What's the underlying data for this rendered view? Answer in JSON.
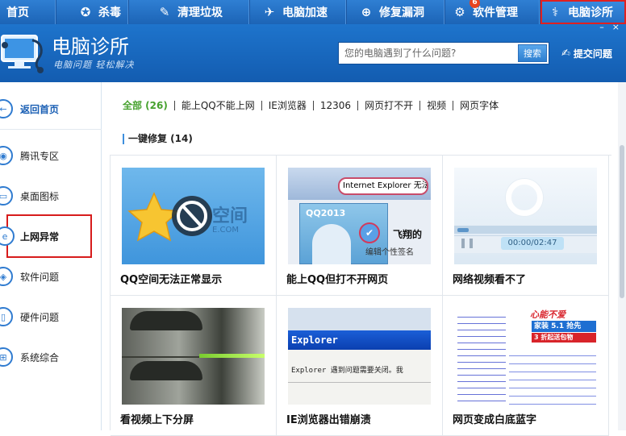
{
  "topnav": {
    "tabs": [
      {
        "label": "首页",
        "icon": "home-icon",
        "glyph": ""
      },
      {
        "label": "杀毒",
        "icon": "shield-icon",
        "glyph": "✪"
      },
      {
        "label": "清理垃圾",
        "icon": "broom-icon",
        "glyph": "✎"
      },
      {
        "label": "电脑加速",
        "icon": "rocket-icon",
        "glyph": "✈"
      },
      {
        "label": "修复漏洞",
        "icon": "repair-icon",
        "glyph": "⊕"
      },
      {
        "label": "软件管理",
        "icon": "software-icon",
        "glyph": "⚙",
        "badge": "6"
      },
      {
        "label": "电脑诊所",
        "icon": "stethoscope-icon",
        "glyph": "⚕"
      }
    ],
    "active_tab": "电脑诊所"
  },
  "header": {
    "title": "电脑诊所",
    "slogan": "电脑问题 轻松解决",
    "search": {
      "placeholder": "您的电脑遇到了什么问题?",
      "button_label": "搜索"
    },
    "feedback_label": "提交问题",
    "window_controls": {
      "minimize": "–",
      "close": "×"
    }
  },
  "sidebar": {
    "items": [
      {
        "label": "返回首页",
        "icon": "back-arrow-icon"
      },
      {
        "label": "腾讯专区",
        "icon": "penguin-icon"
      },
      {
        "label": "桌面图标",
        "icon": "desktop-icon"
      },
      {
        "label": "上网异常",
        "icon": "browser-icon"
      },
      {
        "label": "软件问题",
        "icon": "software-icon"
      },
      {
        "label": "硬件问题",
        "icon": "hardware-icon"
      },
      {
        "label": "系统综合",
        "icon": "windows-icon"
      }
    ],
    "active": "上网异常"
  },
  "main": {
    "filters": [
      "全部 (26)",
      "能上QQ不能上网",
      "IE浏览器",
      "12306",
      "网页打不开",
      "视频",
      "网页字体"
    ],
    "section_title": "一键修复 (14)",
    "cards": [
      {
        "caption": "QQ空间无法正常显示",
        "thumb_text": "空间",
        "thumb_sub": "E.COM"
      },
      {
        "caption": "能上QQ但打不开网页",
        "thumb_text": "Internet Explorer 无法显...",
        "thumb_sub": "QQ2013",
        "thumb_extra": "飞翔的",
        "thumb_sig": "编辑个性签名"
      },
      {
        "caption": "网络视频看不了",
        "thumb_text": "00:00/02:47"
      },
      {
        "caption": "看视频上下分屏"
      },
      {
        "caption": "IE浏览器出错崩溃",
        "thumb_text": "Explorer",
        "thumb_sub": "Explorer 遇到问题需要关闭。我"
      },
      {
        "caption": "网页变成白底蓝字",
        "thumb_text": "心能不爱",
        "thumb_sub": "家装 5.1 抢先",
        "thumb_extra": "3 折起送包物"
      }
    ]
  },
  "colors": {
    "brand_blue": "#1e74cc",
    "highlight_red": "#d71c1c",
    "filter_green": "#46a12e"
  }
}
